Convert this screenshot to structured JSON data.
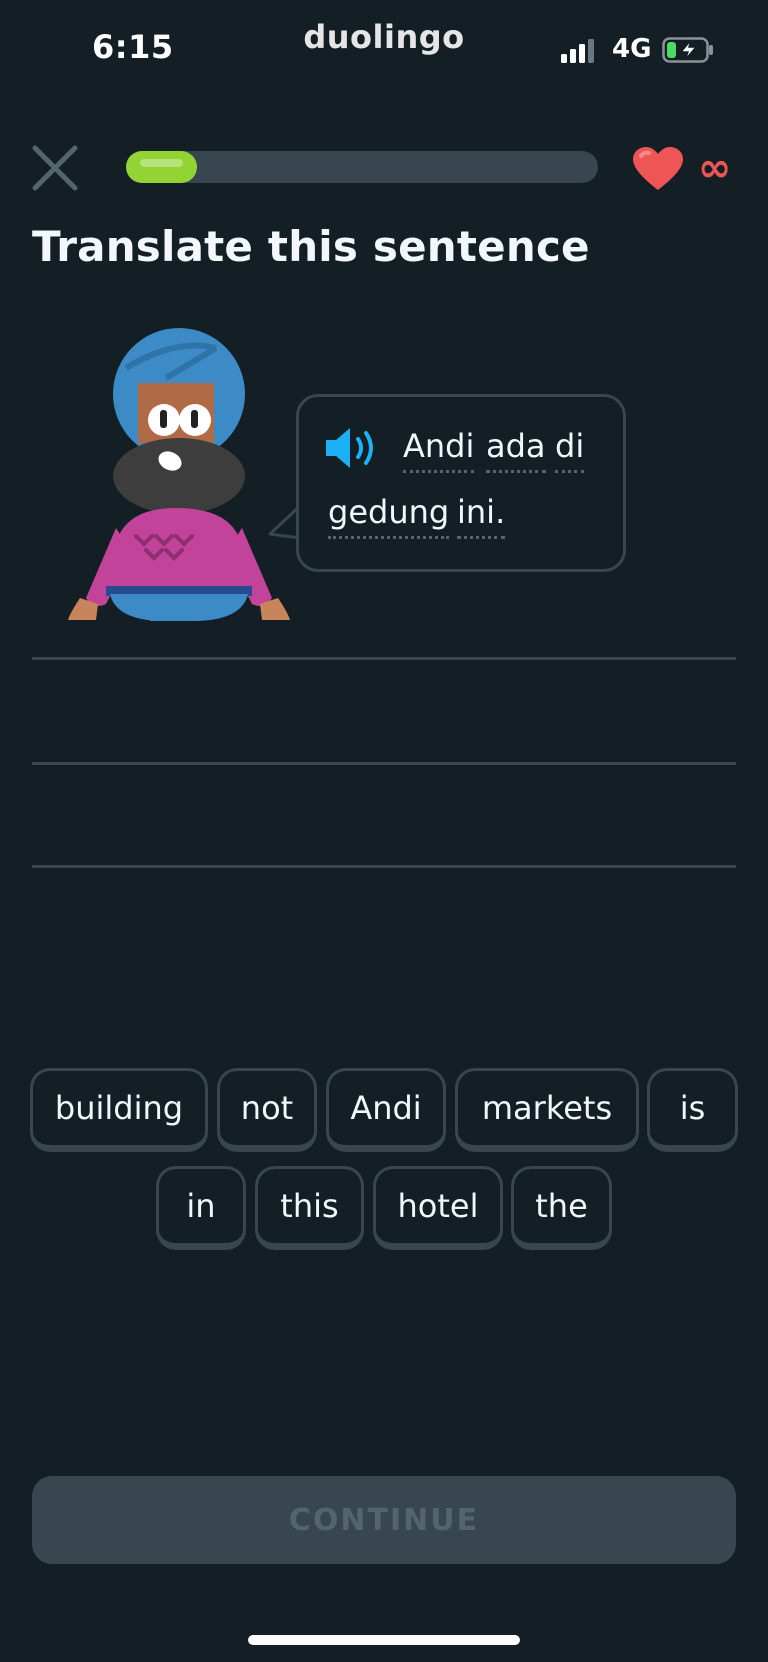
{
  "status_bar": {
    "time": "6:15",
    "center_label": "duolingo",
    "network": "4G",
    "battery_level": 0.25
  },
  "header": {
    "progress": 0.15,
    "hearts": "∞",
    "accent_colors": {
      "progress": "#93d333",
      "heart": "#ee5555"
    }
  },
  "challenge": {
    "title": "Translate this sentence",
    "prompt_words": [
      "Andi",
      "ada",
      "di",
      "gedung",
      "ini."
    ]
  },
  "word_bank": [
    "building",
    "not",
    "Andi",
    "markets",
    "is",
    "in",
    "this",
    "hotel",
    "the"
  ],
  "footer": {
    "continue_label": "CONTINUE"
  },
  "icons": [
    "close-icon",
    "heart-icon",
    "speaker-icon",
    "signal-icon",
    "battery-icon"
  ]
}
